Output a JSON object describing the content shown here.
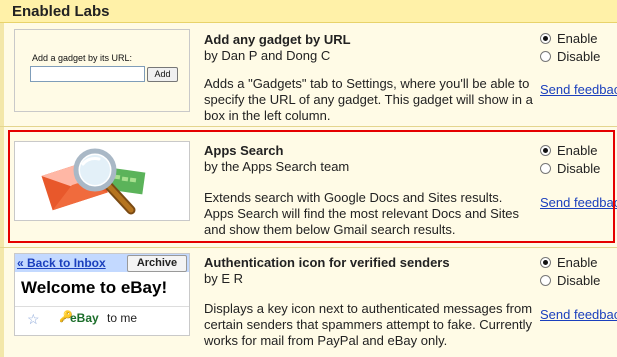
{
  "header": {
    "title": "Enabled Labs"
  },
  "labs": [
    {
      "title": "Add any gadget by URL",
      "byline": "by Dan P and Dong C",
      "description": "Adds a \"Gadgets\" tab to Settings, where you'll be able to specify the URL of any gadget. This gadget will show in a box in the left column.",
      "enable_label": "Enable",
      "disable_label": "Disable",
      "selected": "Enable",
      "feedback_label": "Send feedback",
      "thumb": {
        "label": "Add a gadget by its URL:",
        "input_value": "",
        "button_label": "Add"
      }
    },
    {
      "title": "Apps Search",
      "byline": "by the Apps Search team",
      "description": "Extends search with Google Docs and Sites results. Apps Search will find the most relevant Docs and Sites and show them below Gmail search results.",
      "enable_label": "Enable",
      "disable_label": "Disable",
      "selected": "Enable",
      "feedback_label": "Send feedback",
      "thumb": {
        "icon": "envelope-magnifier-icon"
      }
    },
    {
      "title": "Authentication icon for verified senders",
      "byline": "by E R",
      "description": "Displays a key icon next to authenticated messages from certain senders that spammers attempt to fake. Currently works for mail from PayPal and eBay only.",
      "enable_label": "Enable",
      "disable_label": "Disable",
      "selected": "Enable",
      "feedback_label": "Send feedback",
      "thumb": {
        "back_label": "« Back to Inbox",
        "archive_label": "Archive",
        "welcome": "Welcome to eBay!",
        "from": "eBay",
        "to": "to me"
      }
    }
  ]
}
